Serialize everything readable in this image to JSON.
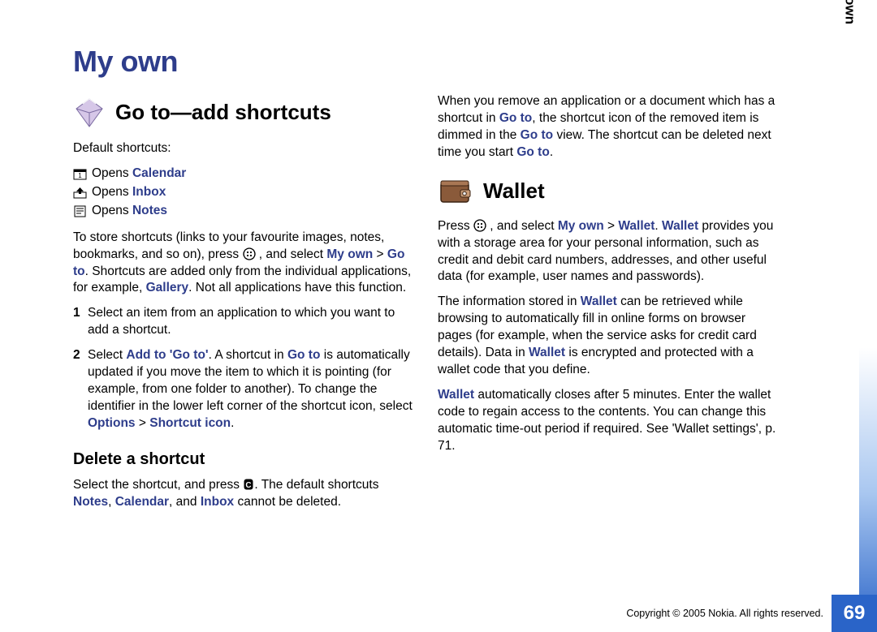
{
  "doc": {
    "title": "My own",
    "side_tab": "My own",
    "page_number": "69",
    "copyright": "Copyright © 2005 Nokia. All rights reserved."
  },
  "left": {
    "section1_title": "Go to—add shortcuts",
    "default_label": "Default shortcuts:",
    "shortcuts": {
      "s1_pre": "Opens ",
      "s1_link": "Calendar",
      "s2_pre": "Opens ",
      "s2_link": "Inbox",
      "s3_pre": "Opens ",
      "s3_link": "Notes"
    },
    "p1_a": "To store shortcuts (links to your favourite images, notes, bookmarks, and so on), press ",
    "p1_b": " , and select ",
    "p1_link1": "My own",
    "p1_gt": " > ",
    "p1_link2": "Go to",
    "p1_c": ". Shortcuts are added only from the individual applications, for example, ",
    "p1_link3": "Gallery",
    "p1_d": ". Not all applications have this function.",
    "step1": "Select an item from an application to which you want to add a shortcut.",
    "step2_a": "Select ",
    "step2_link1": "Add to 'Go to'",
    "step2_b": ". A shortcut in ",
    "step2_link2": "Go to",
    "step2_c": " is automatically updated if you move the item to which it is pointing (for example, from one folder to another). To change the identifier in the lower left corner of the shortcut icon, select ",
    "step2_link3": "Options",
    "step2_gt": " > ",
    "step2_link4": "Shortcut icon",
    "step2_d": ".",
    "subhead": "Delete a shortcut",
    "del_a": "Select the shortcut, and press ",
    "del_b": ". The default shortcuts ",
    "del_link1": "Notes",
    "del_sep1": ", ",
    "del_link2": "Calendar",
    "del_sep2": ", and ",
    "del_link3": "Inbox",
    "del_c": " cannot be deleted."
  },
  "right": {
    "p1_a": "When you remove an application or a document which has a shortcut in ",
    "p1_link1": "Go to",
    "p1_b": ", the shortcut icon of the removed item is dimmed in the ",
    "p1_link2": "Go to",
    "p1_c": " view. The shortcut can be deleted next time you start ",
    "p1_link3": "Go to",
    "p1_d": ".",
    "section2_title": "Wallet",
    "p2_a": "Press ",
    "p2_b": " , and select ",
    "p2_link1": "My own",
    "p2_gt": " > ",
    "p2_link2": "Wallet",
    "p2_c": ". ",
    "p2_link3": "Wallet",
    "p2_d": " provides you with a storage area for your personal information, such as credit and debit card numbers, addresses, and other useful data (for example, user names and passwords).",
    "p3_a": "The information stored in ",
    "p3_link1": "Wallet",
    "p3_b": " can be retrieved while browsing to automatically fill in online forms on browser pages (for example, when the service asks for credit card details). Data in ",
    "p3_link2": "Wallet",
    "p3_c": " is encrypted and protected with a wallet code that you define.",
    "p4_link1": "Wallet",
    "p4_a": " automatically closes after 5 minutes. Enter the wallet code to regain access to the contents. You can change this automatic time-out period if required. See 'Wallet settings', p. 71."
  }
}
